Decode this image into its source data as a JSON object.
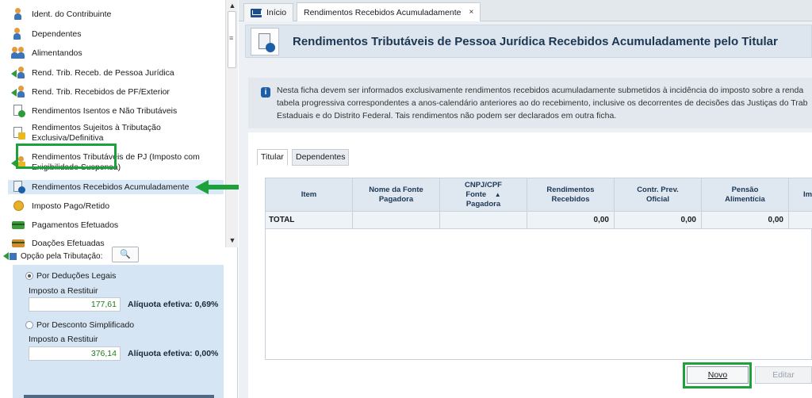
{
  "nav": {
    "items": [
      {
        "label": "Ident. do Contribuinte",
        "icon": "person-icon"
      },
      {
        "label": "Dependentes",
        "icon": "person-icon"
      },
      {
        "label": "Alimentandos",
        "icon": "persons-icon"
      },
      {
        "label": "Rend. Trib. Receb. de Pessoa Jurídica",
        "icon": "income-arrow-icon"
      },
      {
        "label": "Rend. Trib. Recebidos de PF/Exterior",
        "icon": "income-arrow-icon"
      },
      {
        "label": "Rendimentos Isentos e Não Tributáveis",
        "icon": "document-check-icon"
      },
      {
        "label": "Rendimentos Sujeitos à Tributação",
        "label2": "Exclusiva/Definitiva",
        "icon": "document-warning-icon"
      },
      {
        "label": "Rendimentos Tributáveis de PJ (Imposto com",
        "label2": "Exigibilidade Suspensa)",
        "icon": "income-warning-icon"
      },
      {
        "label": "Rendimentos Recebidos Acumuladamente",
        "icon": "document-accumulated-icon"
      },
      {
        "label": "Imposto Pago/Retido",
        "icon": "coin-icon"
      },
      {
        "label": "Pagamentos Efetuados",
        "icon": "payment-card-icon"
      },
      {
        "label": "Doações Efetuadas",
        "icon": "donation-icon"
      }
    ]
  },
  "tax_option": {
    "header": "Opção pela Tributação:",
    "legal_deductions": {
      "label": "Por Deduções Legais",
      "refund_label": "Imposto a Restituir",
      "refund_value": "177,61",
      "rate": "Alíquota efetiva: 0,69%",
      "selected": true
    },
    "simplified": {
      "label": "Por Desconto Simplificado",
      "refund_label": "Imposto a Restituir",
      "refund_value": "376,14",
      "rate": "Alíquota efetiva: 0,00%",
      "selected": false
    }
  },
  "window_tabs": {
    "home": "Início",
    "current": "Rendimentos Recebidos Acumuladamente",
    "close": "×"
  },
  "page": {
    "title": "Rendimentos Tributáveis de Pessoa Jurídica Recebidos Acumuladamente pelo Titular",
    "info_lines": [
      "Nesta ficha devem ser informados exclusivamente rendimentos recebidos acumuladamente submetidos à incidência do imposto sobre a renda",
      "tabela progressiva correspondentes a anos-calendário anteriores ao do recebimento, inclusive os decorrentes de decisões das Justiças do Trab",
      "Estaduais e do Distrito Federal. Tais rendimentos não podem ser declarados em outra ficha."
    ],
    "subtabs": {
      "titular": "Titular",
      "dependentes": "Dependentes"
    }
  },
  "table": {
    "columns": [
      {
        "l1": "Item",
        "l2": "",
        "l3": ""
      },
      {
        "l1": "Nome da Fonte",
        "l2": "Pagadora",
        "l3": ""
      },
      {
        "l1": "CNPJ/CPF",
        "l2": "Fonte",
        "l3": "Pagadora"
      },
      {
        "l1": "Rendimentos",
        "l2": "Recebidos",
        "l3": ""
      },
      {
        "l1": "Contr. Prev.",
        "l2": "Oficial",
        "l3": ""
      },
      {
        "l1": "Pensão",
        "l2": "Alimentícia",
        "l3": ""
      },
      {
        "l1": "Im",
        "l2": "",
        "l3": ""
      }
    ],
    "sort_indicator": "▲",
    "total_row": {
      "label": "TOTAL",
      "rendimentos": "0,00",
      "contr_prev": "0,00",
      "pensao": "0,00"
    }
  },
  "buttons": {
    "novo": "Novo",
    "editar": "Editar"
  },
  "colors": {
    "highlight_green": "#1da13a",
    "title_blue": "#1c3654",
    "refund_green": "#1e7a1e"
  }
}
